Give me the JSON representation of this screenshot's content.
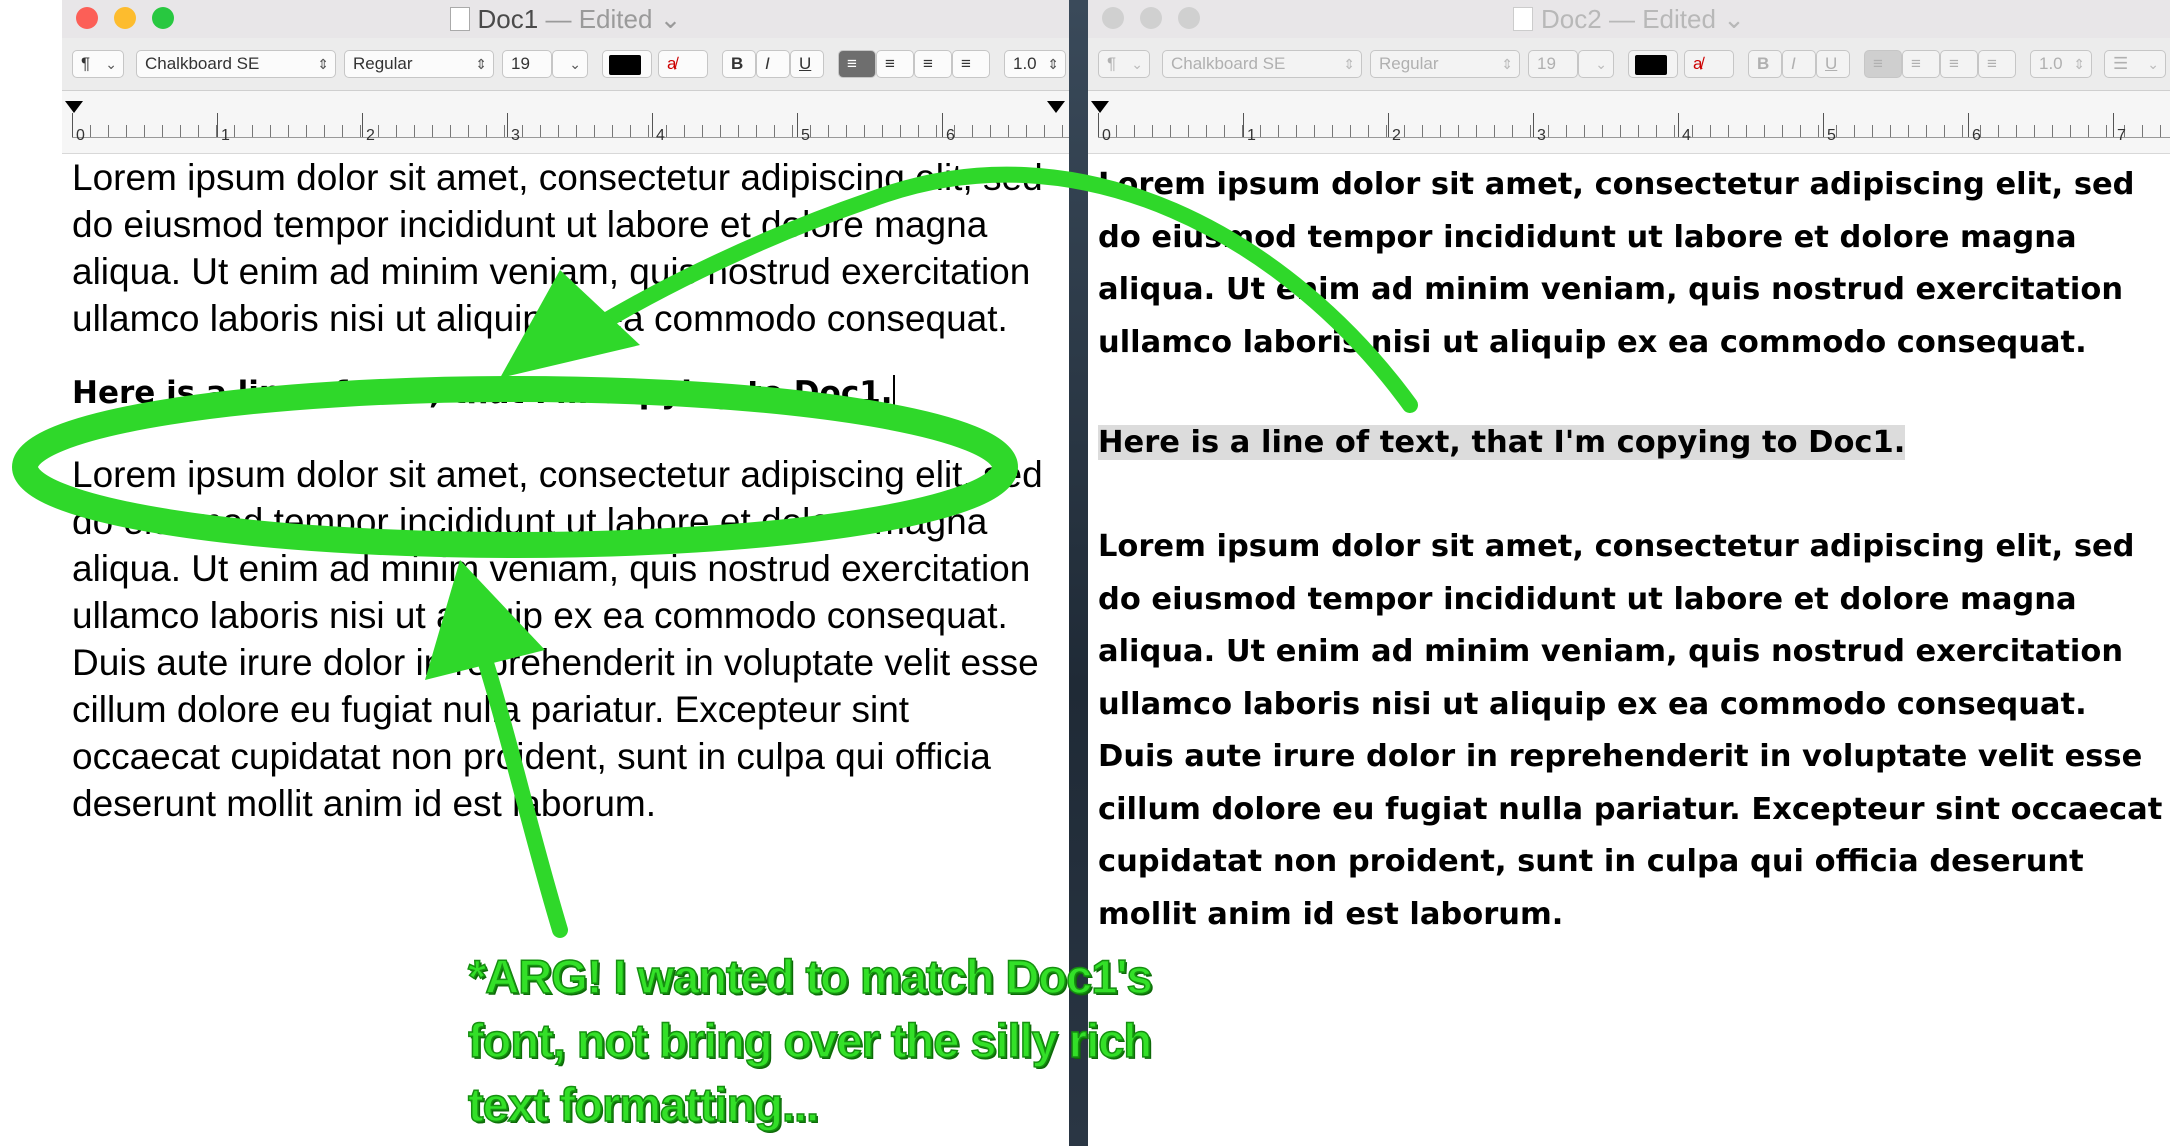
{
  "doc1": {
    "title": "Doc1",
    "status": "— Edited",
    "toolbar": {
      "paragraph_style": "¶",
      "font_family": "Chalkboard SE",
      "font_style": "Regular",
      "font_size": "19",
      "line_spacing": "1.0"
    },
    "ruler_numbers": [
      "0",
      "1",
      "2",
      "3",
      "4",
      "5",
      "6"
    ],
    "para1": "Lorem ipsum dolor sit amet, consectetur adipiscing elit, sed do eiusmod tempor incididunt ut labore et dolore magna aliqua. Ut enim ad minim veniam, quis nostrud exercitation ullamco laboris nisi ut aliquip ex ea commodo consequat.",
    "pasted_line": "Here is a line of text, that I'm copying to Doc1.",
    "para2": "Lorem ipsum dolor sit amet, consectetur adipiscing elit, sed do eiusmod tempor incididunt ut labore et dolore magna aliqua. Ut enim ad minim veniam, quis nostrud exercitation ullamco laboris nisi ut aliquip ex ea commodo consequat. Duis aute irure dolor in reprehenderit in voluptate velit esse cillum dolore eu fugiat nulla pariatur. Excepteur sint occaecat cupidatat non proident, sunt in culpa qui officia deserunt mollit anim id est laborum."
  },
  "doc2": {
    "title": "Doc2",
    "status": "— Edited",
    "toolbar": {
      "paragraph_style": "¶",
      "font_family": "Chalkboard SE",
      "font_style": "Regular",
      "font_size": "19",
      "line_spacing": "1.0"
    },
    "ruler_numbers": [
      "0",
      "1",
      "2",
      "3",
      "4",
      "5",
      "6",
      "7"
    ],
    "para1": "Lorem ipsum dolor sit amet, consectetur adipiscing elit, sed do eiusmod tempor incididunt ut labore et dolore magna aliqua. Ut enim ad minim veniam, quis nostrud exercitation ullamco laboris nisi ut aliquip ex ea commodo consequat.",
    "selected_line": "Here is a line of text, that I'm copying to Doc1.",
    "para2": "Lorem ipsum dolor sit amet, consectetur adipiscing elit, sed do eiusmod tempor incididunt ut labore et dolore magna aliqua. Ut enim ad minim veniam, quis nostrud exercitation ullamco laboris nisi ut aliquip ex ea commodo consequat. Duis aute irure dolor in reprehenderit in voluptate velit esse cillum dolore eu fugiat nulla pariatur. Excepteur sint occaecat cupidatat non proident, sunt in culpa qui officia deserunt mollit anim id est laborum."
  },
  "annotation": {
    "line1": "*ARG!  I wanted to match Doc1's",
    "line2": "font, not bring over the silly rich",
    "line3": "text formatting...",
    "color": "#33e028"
  },
  "icons": [
    "bold-icon",
    "italic-icon",
    "underline-icon",
    "strikethrough-color-icon",
    "align-left-icon",
    "align-center-icon",
    "align-right-icon",
    "justify-icon",
    "list-icon",
    "tab-stop-icon"
  ]
}
